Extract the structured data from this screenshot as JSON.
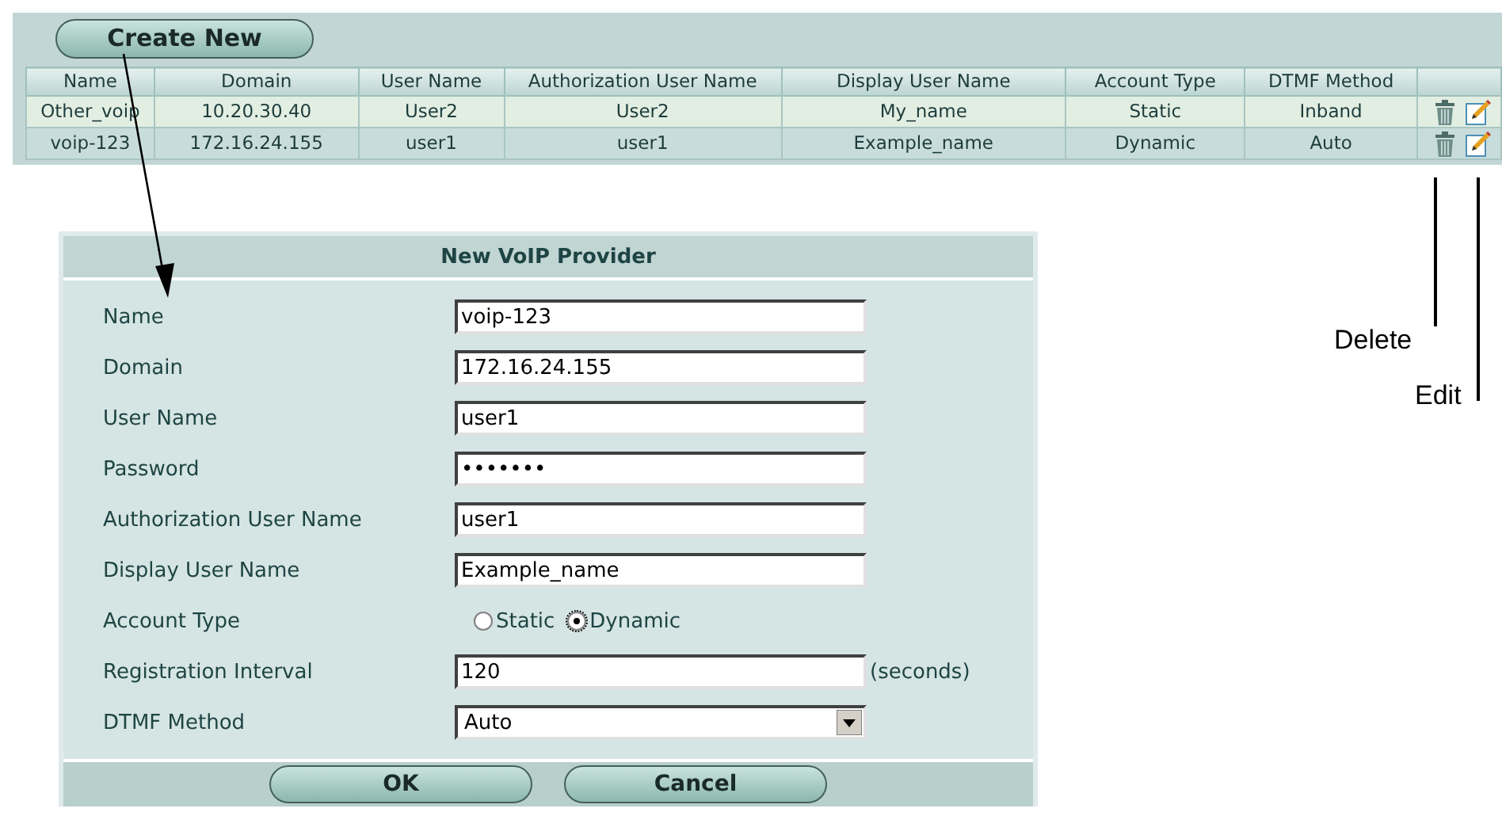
{
  "toolbar": {
    "create_button": "Create New"
  },
  "table": {
    "columns": [
      "Name",
      "Domain",
      "User Name",
      "Authorization User Name",
      "Display User Name",
      "Account Type",
      "DTMF Method"
    ],
    "rows": [
      {
        "cells": [
          "Other_voip",
          "10.20.30.40",
          "User2",
          "User2",
          "My_name",
          "Static",
          "Inband"
        ]
      },
      {
        "cells": [
          "voip-123",
          "172.16.24.155",
          "user1",
          "user1",
          "Example_name",
          "Dynamic",
          "Auto"
        ]
      }
    ]
  },
  "dialog": {
    "title": "New VoIP Provider",
    "fields": [
      {
        "kind": "text",
        "label": "Name",
        "value": "voip-123"
      },
      {
        "kind": "text",
        "label": "Domain",
        "value": "172.16.24.155"
      },
      {
        "kind": "text",
        "label": "User Name",
        "value": "user1"
      },
      {
        "kind": "password",
        "label": "Password",
        "value": "•••••••"
      },
      {
        "kind": "text",
        "label": "Authorization User Name",
        "value": "user1"
      },
      {
        "kind": "text",
        "label": "Display User Name",
        "value": "Example_name"
      },
      {
        "kind": "radio",
        "label": "Account Type",
        "options": [
          {
            "label": "Static",
            "selected": false
          },
          {
            "label": "Dynamic",
            "selected": true
          }
        ]
      },
      {
        "kind": "text",
        "label": "Registration Interval",
        "value": "120",
        "suffix": "(seconds)"
      },
      {
        "kind": "select",
        "label": "DTMF Method",
        "value": "Auto"
      }
    ],
    "buttons": [
      "OK",
      "Cancel"
    ]
  },
  "callouts": {
    "delete": "Delete",
    "edit": "Edit"
  }
}
